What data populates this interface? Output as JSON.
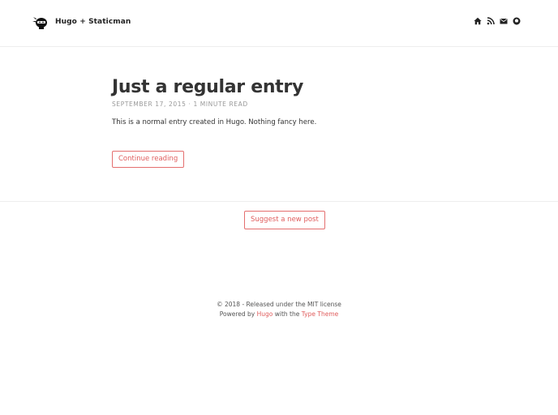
{
  "header": {
    "site_title": "Hugo + Staticman",
    "logo_icon": "ninja-logo-icon",
    "social_icons": [
      "home-icon",
      "rss-icon",
      "envelope-icon",
      "github-icon"
    ]
  },
  "post": {
    "title": "Just a regular entry",
    "meta": "September 17, 2015 · 1 minute read",
    "excerpt": "This is a normal entry created in Hugo. Nothing fancy here.",
    "continue_label": "Continue reading"
  },
  "actions": {
    "suggest_label": "Suggest a new post"
  },
  "footer": {
    "copyright": "© 2018 - Released under the MIT license",
    "powered_prefix": "Powered by",
    "hugo_link": "Hugo",
    "with_text": "with the",
    "theme_link": "Type Theme"
  },
  "colors": {
    "accent": "#e05d5d",
    "text": "#333333",
    "muted": "#999999",
    "border": "#eeeeee"
  }
}
